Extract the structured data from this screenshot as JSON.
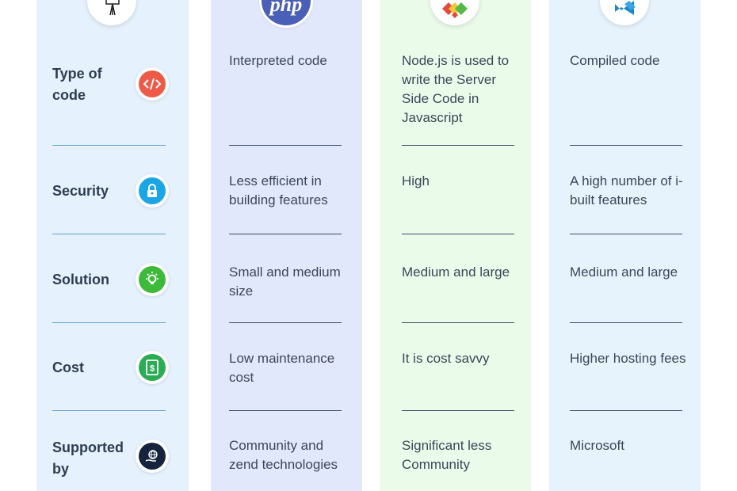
{
  "rows": {
    "type_of_code": {
      "label": "Type of code",
      "php": "Interpreted code",
      "node": "Node.js is used to write the Server Side Code in Javascript",
      "net": "Compiled code"
    },
    "security": {
      "label": "Security",
      "php": "Less efficient in building features",
      "node": "High",
      "net": "A high number of i-built features"
    },
    "solution": {
      "label": "Solution",
      "php": "Small and medium size",
      "node": "Medium and large",
      "net": "Medium and large"
    },
    "cost": {
      "label": "Cost",
      "php": "Low maintenance cost",
      "node": "It is cost savvy",
      "net": "Higher hosting fees"
    },
    "supported_by": {
      "label": "Supported by",
      "php": "Community and zend technologies",
      "node": "Significant less Community",
      "net": "Microsoft"
    }
  },
  "logos": {
    "php_text": "php"
  },
  "icons": {
    "type_of_code": "code-icon",
    "security": "lock-icon",
    "solution": "lightbulb-icon",
    "cost": "dollar-icon",
    "supported_by": "globe-hand-icon"
  },
  "colors": {
    "code": "#ee5a48",
    "security": "#1aa6e4",
    "solution": "#3dba3a",
    "cost": "#2cab55",
    "supported_by": "#16233d"
  }
}
